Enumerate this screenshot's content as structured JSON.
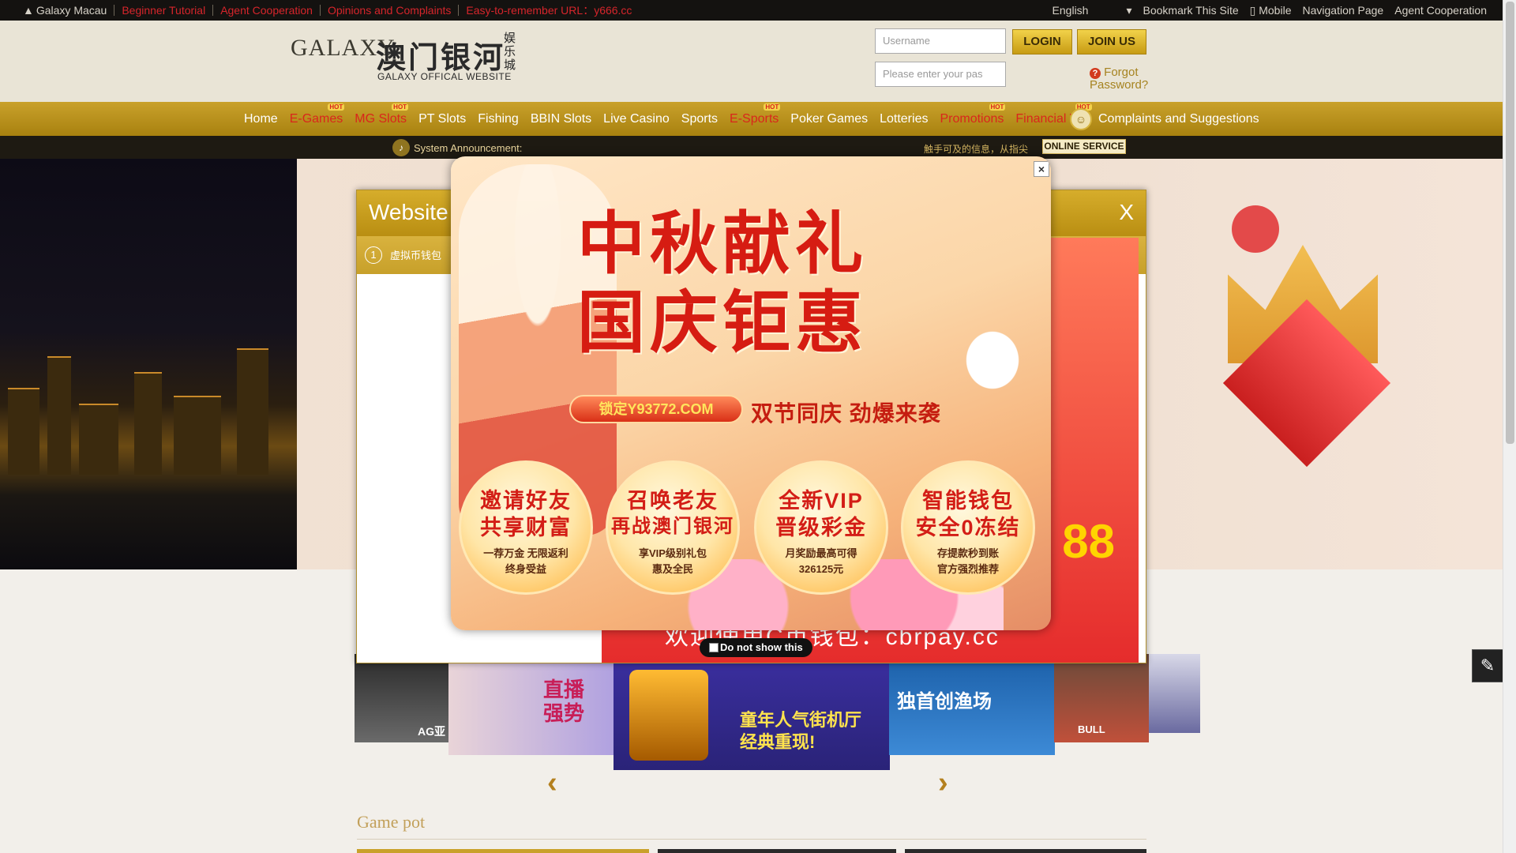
{
  "topbar": {
    "brand": "Galaxy Macau",
    "links": [
      "Beginner Tutorial",
      "Agent Cooperation",
      "Opinions and Complaints",
      "Easy-to-remember URL：y666.cc"
    ],
    "language": "English",
    "right_links": [
      "Bookmark This Site",
      "Mobile",
      "Navigation Page",
      "Agent Cooperation"
    ]
  },
  "logo": {
    "brand_text": "GALAXY",
    "cn": "澳门银河",
    "en": "GALAXY OFFICAL WEBSITE",
    "tag": "娱乐城"
  },
  "login": {
    "username_placeholder": "Username",
    "password_placeholder": "Please enter your pas",
    "login_label": "LOGIN",
    "join_label": "JOIN US",
    "forgot_label": "Forgot Password?"
  },
  "nav": {
    "items": [
      {
        "label": "Home",
        "hot": false
      },
      {
        "label": "E-Games",
        "hot": true
      },
      {
        "label": "MG Slots",
        "hot": true
      },
      {
        "label": "PT Slots",
        "hot": false
      },
      {
        "label": "Fishing",
        "hot": false
      },
      {
        "label": "BBIN Slots",
        "hot": false
      },
      {
        "label": "Live Casino",
        "hot": false
      },
      {
        "label": "Sports",
        "hot": false
      },
      {
        "label": "E-Sports",
        "hot": true
      },
      {
        "label": "Poker Games",
        "hot": false
      },
      {
        "label": "Lotteries",
        "hot": false
      },
      {
        "label": "Promotions",
        "hot": true
      },
      {
        "label": "Financial VIP",
        "hot": true
      }
    ],
    "hot_badge": "HOT",
    "complaints": "Complaints and Suggestions"
  },
  "announcement": {
    "label": "System Announcement:",
    "marquee": "触手可及的信息，从指尖",
    "online_service": "ONLINE SERVICE"
  },
  "modal_back": {
    "title": "Website",
    "close": "X",
    "row_num": "1",
    "row_text": "虚拟币钱包",
    "promo_text": "欢迎使用C币钱包：cbrpay.cc",
    "big_digits": "88"
  },
  "popup": {
    "title_line1": "中秋献礼",
    "title_line2": "国庆钜惠",
    "pill": "锁定Y93772.COM",
    "slogan": "双节同庆 劲爆来袭",
    "close": "×",
    "coins": [
      {
        "h1": "邀请好友",
        "h2": "共享财富",
        "s1": "一荐万金 无限返利",
        "s2": "终身受益"
      },
      {
        "h1": "召唤老友",
        "h2": "再战澳门银河",
        "s1": "享VIP级别礼包",
        "s2": "惠及全民"
      },
      {
        "h1": "全新VIP",
        "h2": "晋级彩金",
        "s1": "月奖励最高可得",
        "s2": "326125元"
      },
      {
        "h1": "智能钱包",
        "h2": "安全0冻结",
        "s1": "存提款秒到账",
        "s2": "官方强烈推荐"
      }
    ],
    "dont_show": "Do not show this"
  },
  "games": {
    "tiles": [
      {
        "label": "AG亚"
      },
      {
        "label": "直播 强势"
      },
      {
        "label": "童年人气街机厅 经典重现!"
      },
      {
        "label": "独首创渔场"
      },
      {
        "label": "BULL"
      }
    ]
  },
  "gamepot": {
    "title": "Game pot"
  },
  "colors": {
    "gold": "#c9a12b",
    "hot_red": "#d9261c",
    "topbar_bg": "#141210"
  }
}
